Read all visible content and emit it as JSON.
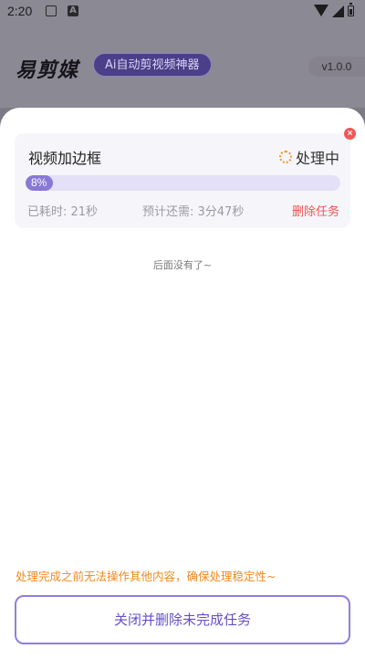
{
  "status_bar": {
    "time": "2:20",
    "icons": [
      "image-icon",
      "a-icon",
      "wifi-icon",
      "signal-icon",
      "battery-icon"
    ],
    "a_glyph": "A"
  },
  "header": {
    "logo": "易剪媒",
    "slogan": "Ai自动剪视频神器",
    "version": "v1.0.0"
  },
  "task": {
    "title": "视频加边框",
    "status": "处理中",
    "progress_label": "8%",
    "progress_fraction": 0.08,
    "elapsed": "已耗时: 21秒",
    "remaining": "预计还需: 3分47秒",
    "delete_label": "删除任务",
    "close_glyph": "×"
  },
  "list_end": "后面没有了~",
  "warning": "处理完成之前无法操作其他内容，确保处理稳定性~",
  "close_button_label": "关闭并删除未完成任务",
  "colors": {
    "accent": "#8a78d7",
    "warning": "#ef8a1f",
    "danger": "#f0534f",
    "button_text": "#6350c9"
  }
}
